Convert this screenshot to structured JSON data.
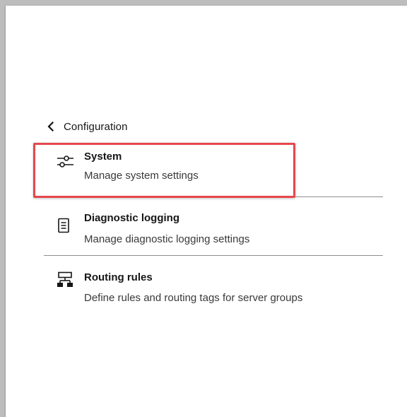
{
  "nav": {
    "back_label": "Configuration",
    "back_icon": "chevron-left-icon"
  },
  "menu": {
    "items": [
      {
        "title": "System",
        "description": "Manage system settings",
        "icon": "settings-adjust-icon",
        "highlighted": true
      },
      {
        "title": "Diagnostic logging",
        "description": "Manage diagnostic logging settings",
        "icon": "document-icon",
        "highlighted": false
      },
      {
        "title": "Routing rules",
        "description": "Define rules and routing tags for server groups",
        "icon": "network-icon",
        "highlighted": false
      }
    ]
  },
  "colors": {
    "highlight_border": "#e5484d",
    "text_primary": "#161616",
    "text_secondary": "#393939",
    "divider": "#8d8d8d"
  }
}
